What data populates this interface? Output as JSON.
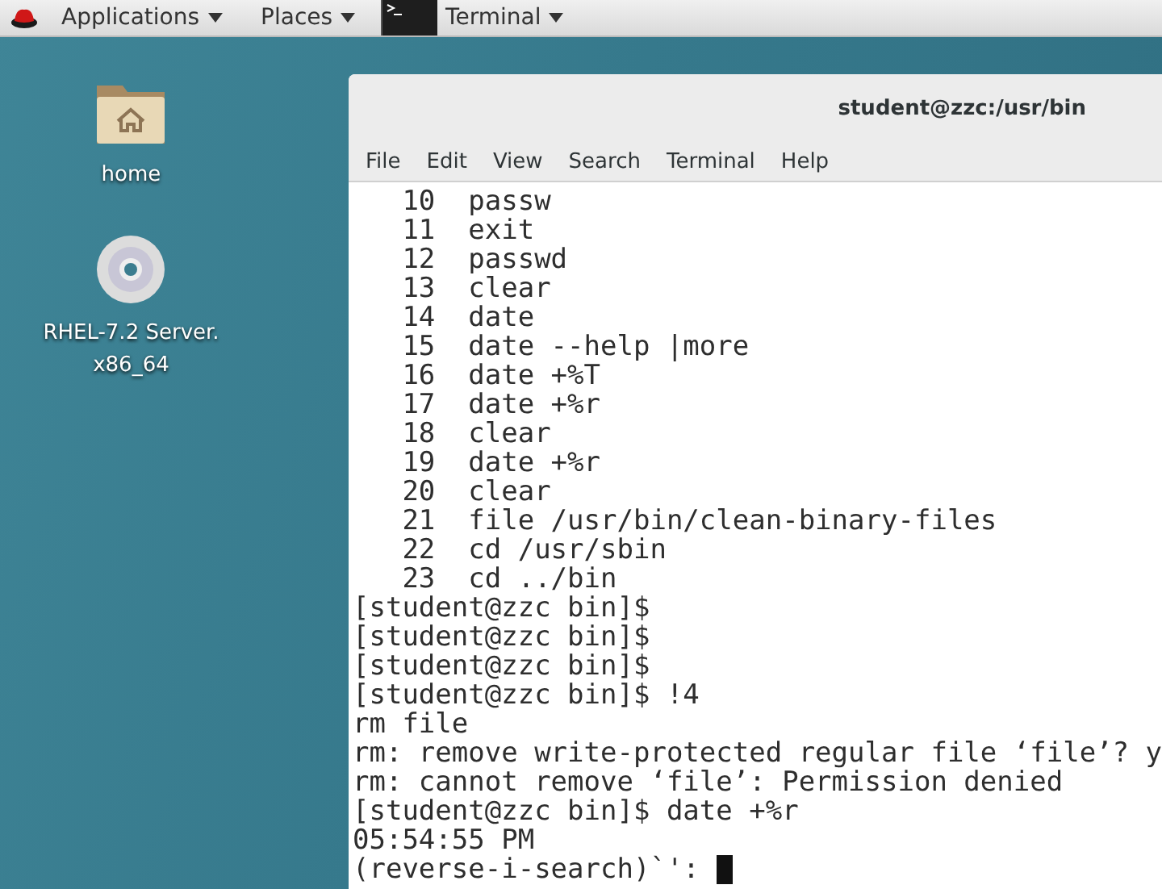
{
  "top_bar": {
    "menus": [
      "Applications",
      "Places"
    ],
    "active_app": "Terminal"
  },
  "desktop_icons": [
    {
      "kind": "folder",
      "label": "home"
    },
    {
      "kind": "disc",
      "label": "RHEL-7.2 Server.\nx86_64"
    }
  ],
  "terminal": {
    "title": "student@zzc:/usr/bin",
    "menu": [
      "File",
      "Edit",
      "View",
      "Search",
      "Terminal",
      "Help"
    ],
    "lines": [
      "   10  passw",
      "   11  exit",
      "   12  passwd",
      "   13  clear",
      "   14  date",
      "   15  date --help |more",
      "   16  date +%T",
      "   17  date +%r",
      "   18  clear",
      "   19  date +%r",
      "   20  clear",
      "   21  file /usr/bin/clean-binary-files",
      "   22  cd /usr/sbin",
      "   23  cd ../bin",
      "[student@zzc bin]$",
      "[student@zzc bin]$",
      "[student@zzc bin]$",
      "[student@zzc bin]$ !4",
      "rm file",
      "rm: remove write-protected regular file ‘file’? y",
      "rm: cannot remove ‘file’: Permission denied",
      "[student@zzc bin]$ date +%r",
      "05:54:55 PM"
    ],
    "input_line": {
      "text": "(reverse-i-search)`': ",
      "cursor": true
    }
  }
}
